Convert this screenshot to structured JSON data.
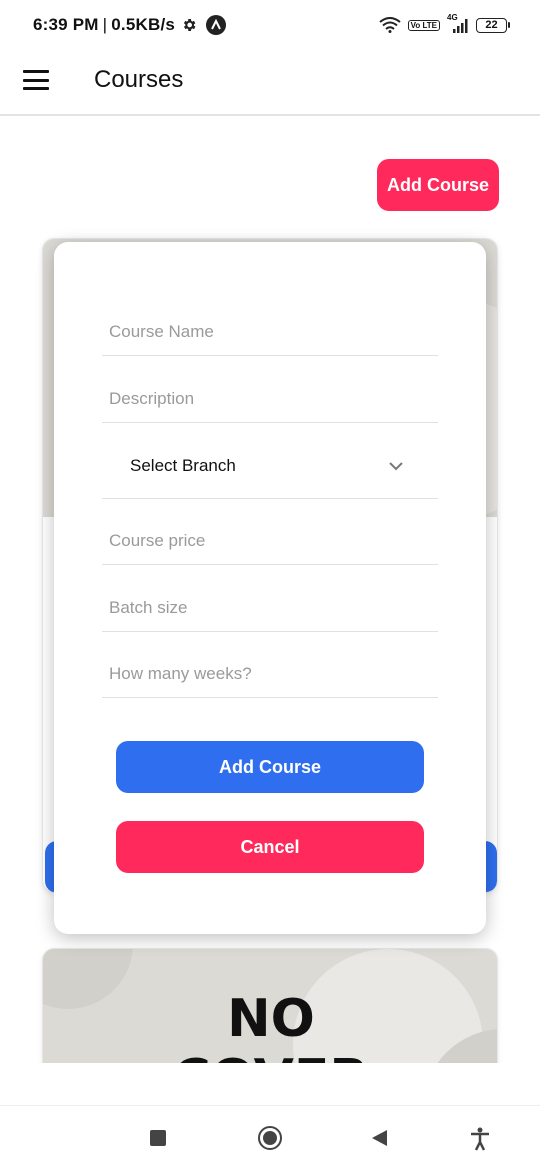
{
  "status_bar": {
    "time": "6:39 PM",
    "separator": "|",
    "speed": "0.5KB/s",
    "network": "4G",
    "volte": "Vo LTE",
    "battery": "22"
  },
  "app_bar": {
    "title": "Courses"
  },
  "toolbar": {
    "add_course_label": "Add Course"
  },
  "background_card": {
    "no_cover_line1": "NO",
    "no_cover_line2": "COVER"
  },
  "modal": {
    "course_name_placeholder": "Course Name",
    "description_placeholder": "Description",
    "branch_select_value": "Select Branch",
    "price_placeholder": "Course price",
    "batch_size_placeholder": "Batch size",
    "weeks_placeholder": "How many weeks?",
    "add_button_label": "Add Course",
    "cancel_button_label": "Cancel"
  },
  "colors": {
    "primary_blue": "#2f6fef",
    "accent_pink": "#ff2a5b"
  },
  "icons": [
    "menu-icon",
    "gear-icon",
    "app-a-icon",
    "wifi-icon",
    "signal-icon",
    "battery-icon",
    "chevron-down-icon",
    "nav-recents-icon",
    "nav-home-icon",
    "nav-back-icon",
    "accessibility-icon"
  ]
}
